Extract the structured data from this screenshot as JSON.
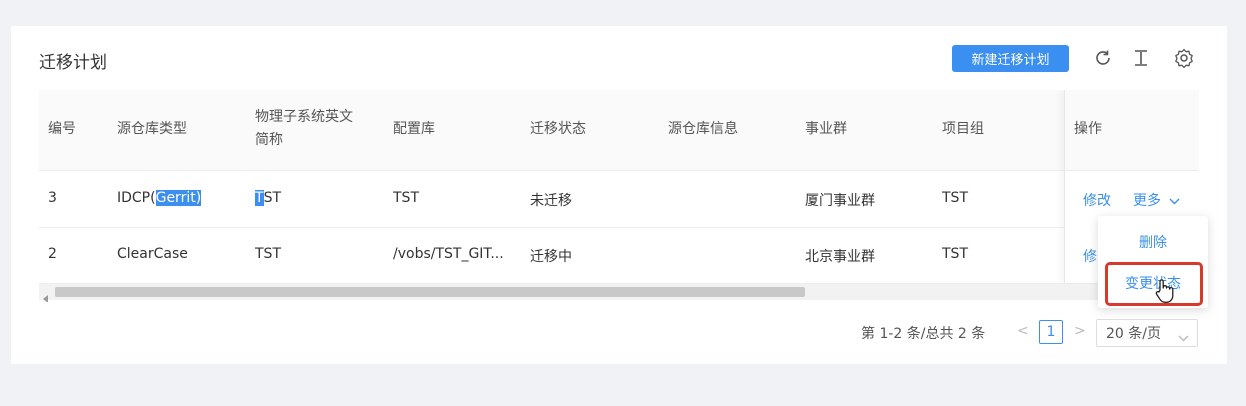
{
  "card": {
    "title": "迁移计划",
    "new_button": "新建迁移计划"
  },
  "toolbar": {
    "icons": [
      "refresh-icon",
      "column-height-icon",
      "settings-icon"
    ]
  },
  "table": {
    "headers": {
      "id": "编号",
      "source_repo_type": "源仓库类型",
      "physical_name_line1": "物理子系统英文",
      "physical_name_line2": "简称",
      "config_repo": "配置库",
      "migration_status": "迁移状态",
      "source_repo_info": "源仓库信息",
      "business_group": "事业群",
      "project_group": "项目组",
      "actions": "操作"
    },
    "rows": [
      {
        "id": "3",
        "source_repo_type_prefix": "IDCP(",
        "source_repo_type_selected": "Gerrit)",
        "physical_selected": "T",
        "physical_rest": "ST",
        "config_repo": "TST",
        "migration_status": "未迁移",
        "source_repo_info": "",
        "business_group": "厦门事业群",
        "project_group": "TST",
        "edit": "修改",
        "more": "更多"
      },
      {
        "id": "2",
        "source_repo_type": "ClearCase",
        "physical": "TST",
        "config_repo": "/vobs/TST_GIT...",
        "migration_status": "迁移中",
        "source_repo_info": "",
        "business_group": "北京事业群",
        "project_group": "TST",
        "edit": "修改"
      }
    ]
  },
  "dropdown": {
    "items": [
      "删除",
      "变更状态"
    ]
  },
  "pagination": {
    "summary": "第 1-2 条/总共 2 条",
    "prev": "<",
    "current_page": "1",
    "next": ">",
    "page_size": "20 条/页"
  },
  "colors": {
    "accent": "#3b8ff0",
    "highlight_box": "#d9382c",
    "background": "#f0f2f5"
  }
}
